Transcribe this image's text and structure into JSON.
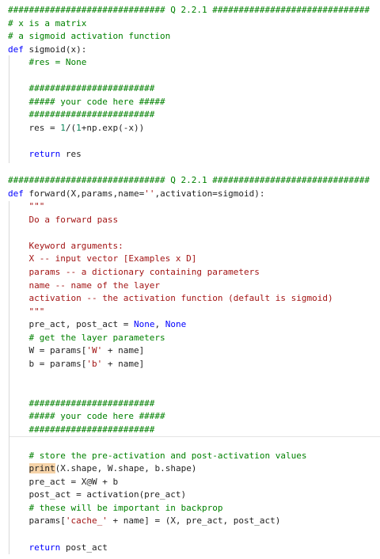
{
  "code": {
    "lines": [
      "############################## Q 2.2.1 ##############################",
      "# x is a matrix",
      "# a sigmoid activation function",
      "def sigmoid(x):",
      "    #res = None",
      "",
      "    ########################",
      "    ##### your code here #####",
      "    ########################",
      "    res = 1/(1+np.exp(-x))",
      "",
      "    return res",
      "",
      "############################## Q 2.2.1 ##############################",
      "def forward(X,params,name='',activation=sigmoid):",
      "    \"\"\"",
      "    Do a forward pass",
      "",
      "    Keyword arguments:",
      "    X -- input vector [Examples x D]",
      "    params -- a dictionary containing parameters",
      "    name -- name of the layer",
      "    activation -- the activation function (default is sigmoid)",
      "    \"\"\"",
      "    pre_act, post_act = None, None",
      "    # get the layer parameters",
      "    W = params['W' + name]",
      "    b = params['b' + name]",
      "",
      "",
      "    ########################",
      "    ##### your code here #####",
      "    ########################",
      "",
      "    # store the pre-activation and post-activation values",
      "    print(X.shape, W.shape, b.shape)",
      "    pre_act = X@W + b",
      "    post_act = activation(pre_act)",
      "    # these will be important in backprop",
      "    params['cache_' + name] = (X, pre_act, post_act)",
      "",
      "    return post_act"
    ]
  },
  "colors": {
    "comment": "#008000",
    "keyword": "#0000ff",
    "string": "#a31515",
    "number": "#098658",
    "highlight": "#f6d3a8"
  }
}
